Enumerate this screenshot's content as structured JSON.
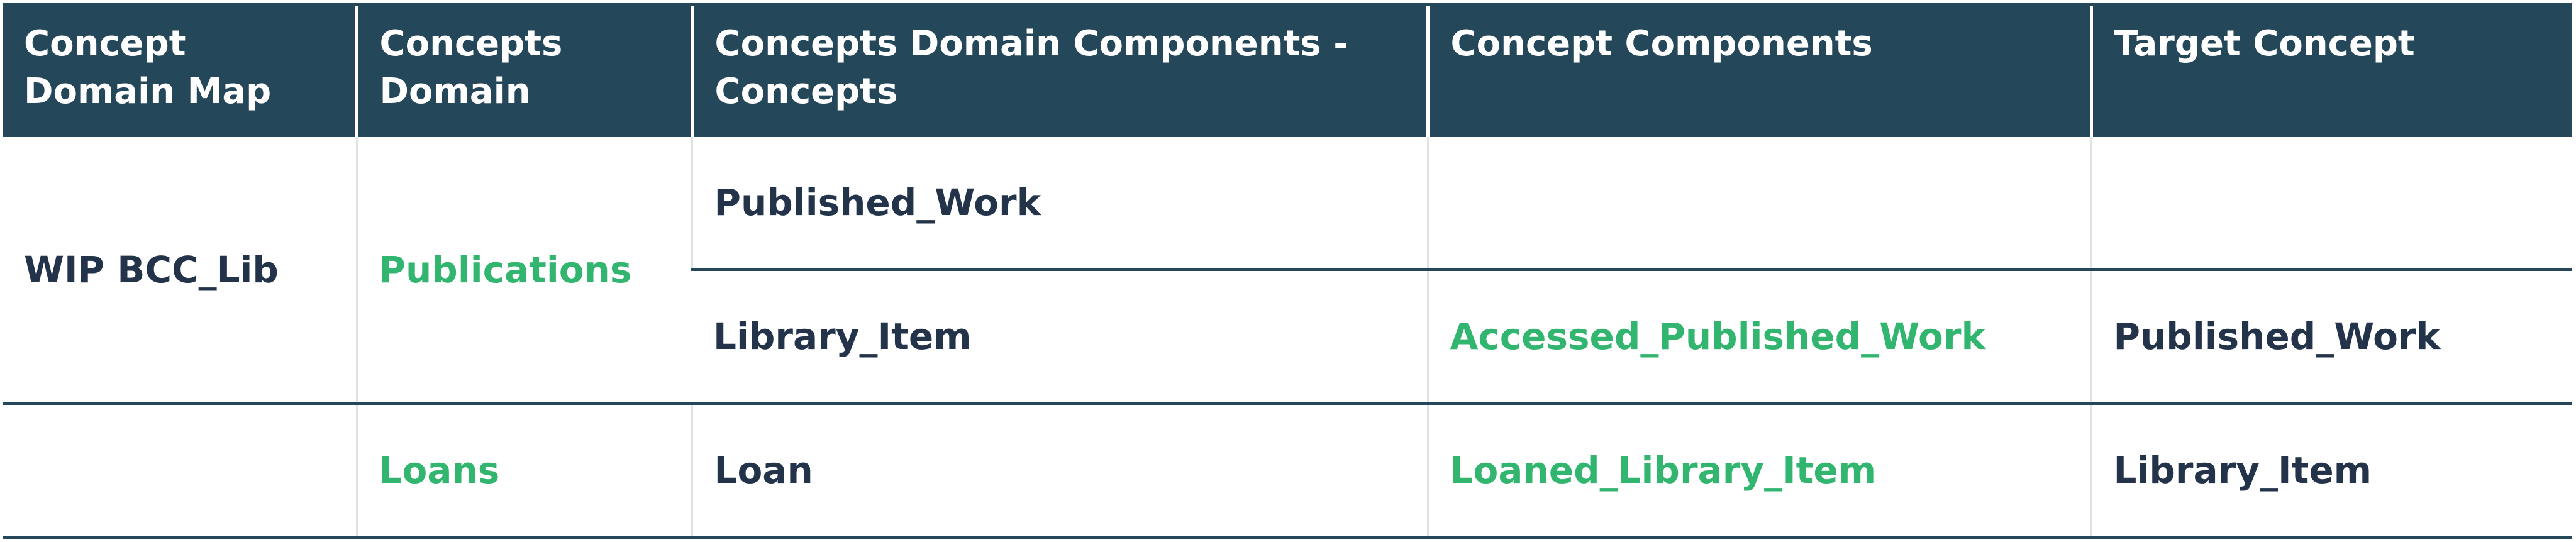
{
  "colors": {
    "header_bg": "#25475a",
    "text": "#22334a",
    "accent": "#32b56f"
  },
  "table": {
    "headers": [
      "Concept Domain Map",
      "Concepts Domain",
      "Concepts Domain Components - Concepts",
      "Concept Components",
      "Target Concept"
    ],
    "map": "WIP BCC_Lib",
    "rows": [
      {
        "domain": "Publications",
        "concept": "Published_Work",
        "component": "",
        "target": ""
      },
      {
        "concept": "Library_Item",
        "component": "Accessed_Published_Work",
        "target": "Published_Work"
      },
      {
        "domain": "Loans",
        "concept": "Loan",
        "component": "Loaned_Library_Item",
        "target": "Library_Item"
      }
    ]
  }
}
